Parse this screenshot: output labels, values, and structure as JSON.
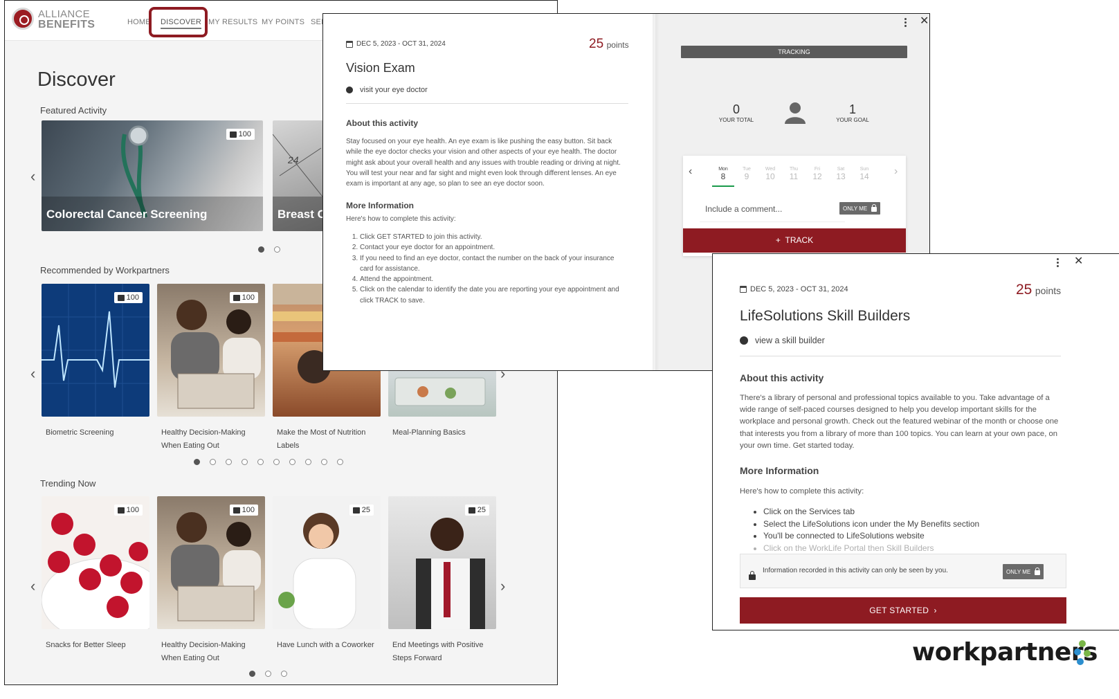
{
  "app": {
    "brand": {
      "line1": "ALLIANCE",
      "line2": "BENEFITS"
    },
    "nav": [
      "HOME",
      "DISCOVER",
      "MY RESULTS",
      "MY POINTS",
      "SEF"
    ],
    "page_title": "Discover",
    "featured": {
      "title": "Featured Activity",
      "cards": [
        {
          "title": "Colorectal Cancer Screening",
          "points": "100"
        },
        {
          "title": "Breast C"
        }
      ]
    },
    "recommended": {
      "title": "Recommended by Workpartners",
      "cards": [
        {
          "title": "Biometric Screening",
          "points": "100"
        },
        {
          "title": "Healthy Decision-Making When Eating Out",
          "points": "100"
        },
        {
          "title": "Make the Most of Nutrition Labels"
        },
        {
          "title": "Meal-Planning Basics"
        }
      ]
    },
    "trending": {
      "title": "Trending Now",
      "cards": [
        {
          "title": "Snacks for Better Sleep",
          "points": "100"
        },
        {
          "title": "Healthy Decision-Making When Eating Out",
          "points": "100"
        },
        {
          "title": "Have Lunch with a Coworker",
          "points": "25"
        },
        {
          "title": "End Meetings with Positive Steps Forward",
          "points": "25"
        }
      ]
    }
  },
  "vision_dialog": {
    "date_range": "DEC 5, 2023 - OCT 31, 2024",
    "points": "25",
    "points_word": "points",
    "title": "Vision Exam",
    "hint": "visit your eye doctor",
    "about_title": "About this activity",
    "about_text": "Stay focused on your eye health. An eye exam is like pushing the easy button. Sit back while the eye doctor checks your vision and other aspects of your eye health. The doctor might ask about your overall health and any issues with trouble reading or driving at night. You will test your near and far sight and might even look through different lenses. An eye exam is important at any age, so plan to see an eye doctor soon.",
    "more_title": "More Information",
    "more_intro": "Here's how to complete this activity:",
    "steps": [
      "Click GET STARTED to join this activity.",
      "Contact your eye doctor for an appointment.",
      "If you need to find an eye doctor, contact the number on the back of your insurance card for assistance.",
      "Attend the appointment.",
      "Click on the calendar to identify the date you are reporting your eye appointment and click TRACK to save."
    ],
    "tracking": {
      "header": "TRACKING",
      "your_total_value": "0",
      "your_total_label": "YOUR TOTAL",
      "your_goal_value": "1",
      "your_goal_label": "YOUR GOAL",
      "days": [
        {
          "name": "Mon",
          "num": "8"
        },
        {
          "name": "Tue",
          "num": "9"
        },
        {
          "name": "Wed",
          "num": "10"
        },
        {
          "name": "Thu",
          "num": "11"
        },
        {
          "name": "Fri",
          "num": "12"
        },
        {
          "name": "Sat",
          "num": "13"
        },
        {
          "name": "Sun",
          "num": "14"
        }
      ],
      "comment_placeholder": "Include a comment...",
      "only_me": "ONLY ME",
      "track_button": "TRACK"
    }
  },
  "life_dialog": {
    "date_range": "DEC 5, 2023 - OCT 31, 2024",
    "points": "25",
    "points_word": "points",
    "title": "LifeSolutions Skill Builders",
    "hint": "view a skill builder",
    "about_title": "About this activity",
    "about_text": "There's a library of personal and professional topics available to you. Take advantage of a wide range of self-paced courses designed to help you develop important skills for the workplace and personal growth. Check out the featured webinar of the month or choose one that interests you from a library of more than 100 topics. You can learn at your own pace, on your own time. Get started today.",
    "more_title": "More Information",
    "more_intro": "Here's how to complete this activity:",
    "steps": [
      "Click on the Services tab",
      "Select the LifeSolutions icon under the My Benefits section",
      "You'll be connected to LifeSolutions website",
      "Click on the WorkLife Portal then Skill Builders"
    ],
    "notice": "Information recorded in this activity can only be seen by you.",
    "only_me": "ONLY ME",
    "start_button": "GET STARTED"
  },
  "footer_logo": "workpartners",
  "colors": {
    "brand": "#8e1b22",
    "accent_green": "#1a9a4a"
  }
}
